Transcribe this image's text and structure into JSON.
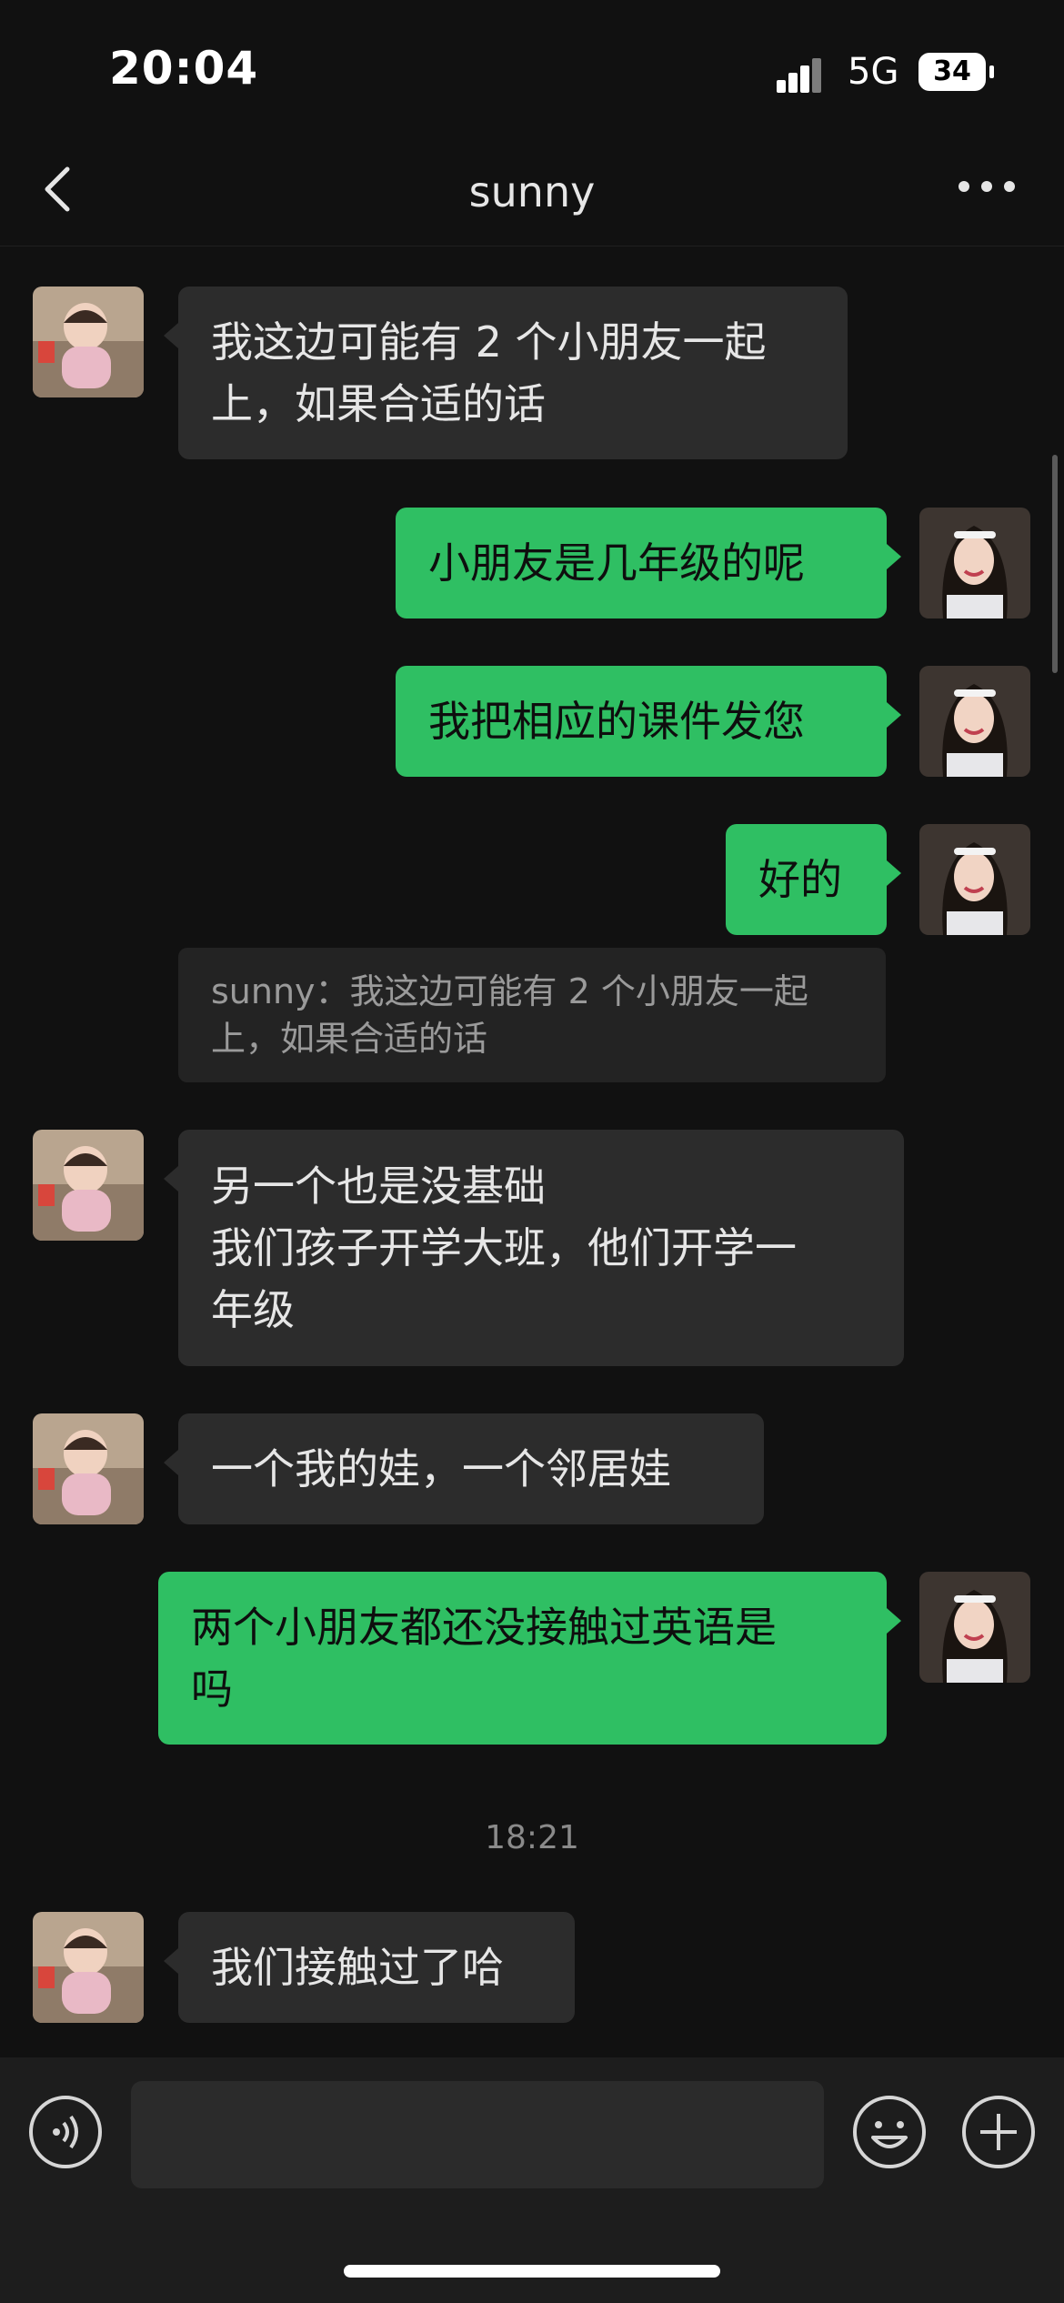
{
  "status_bar": {
    "time": "20:04",
    "network": "5G",
    "battery": "34"
  },
  "nav": {
    "title": "sunny",
    "back_icon": "chevron-left-icon",
    "more_icon": "more-horizontal-icon"
  },
  "messages": [
    {
      "from": "sunny",
      "lines": [
        "我这边可能有 2 个小朋友一起",
        "上，如果合适的话"
      ]
    },
    {
      "from": "me",
      "lines": [
        "小朋友是几年级的呢"
      ]
    },
    {
      "from": "me",
      "lines": [
        "我把相应的课件发您"
      ]
    },
    {
      "from": "me",
      "lines": [
        "好的"
      ]
    },
    {
      "from": "quote",
      "lines": [
        "sunny：我这边可能有 2 个小朋友一起",
        "上，如果合适的话"
      ]
    },
    {
      "from": "sunny",
      "lines": [
        "另一个也是没基础",
        "我们孩子开学大班，他们开学一",
        "年级"
      ]
    },
    {
      "from": "sunny",
      "lines": [
        "一个我的娃，一个邻居娃"
      ]
    },
    {
      "from": "me",
      "lines": [
        "两个小朋友都还没接触过英语是",
        "吗"
      ]
    },
    {
      "from": "timestamp",
      "lines": [
        "18:21"
      ]
    },
    {
      "from": "sunny",
      "lines": [
        "我们接触过了哈"
      ]
    }
  ],
  "input": {
    "placeholder": ""
  },
  "colors": {
    "background": "#111111",
    "incoming_bubble": "#2c2c2c",
    "outgoing_bubble": "#2fbf63",
    "input_bar": "#1d1d1d"
  },
  "icons": {
    "voice": "voice-icon",
    "emoji": "emoji-icon",
    "plus": "plus-icon"
  }
}
